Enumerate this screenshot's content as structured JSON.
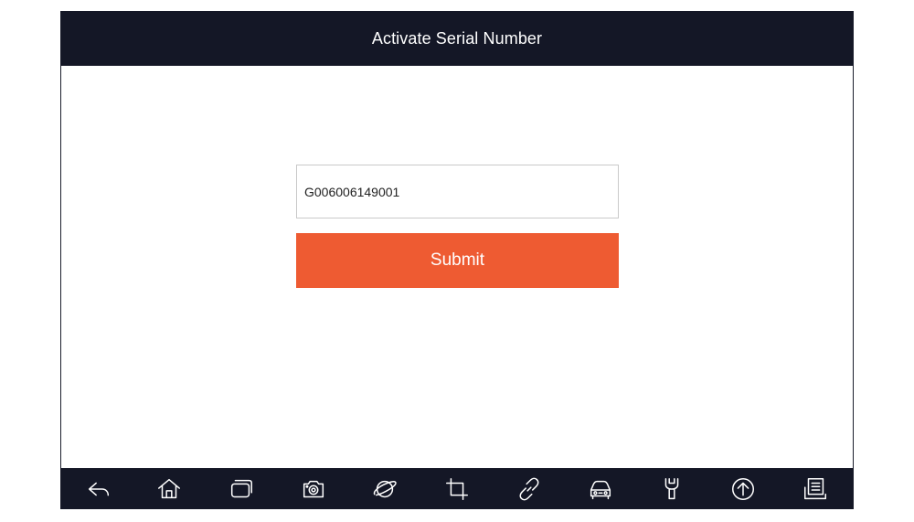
{
  "header": {
    "title": "Activate Serial Number"
  },
  "form": {
    "serial_value": "G006006149001",
    "submit_label": "Submit"
  },
  "colors": {
    "title_bar": "#141726",
    "submit_button": "#ee5b32",
    "nav_bar": "#141726"
  },
  "nav_bar": {
    "icons": [
      "back-icon",
      "home-icon",
      "recent-apps-icon",
      "camera-icon",
      "browser-icon",
      "crop-icon",
      "link-icon",
      "vehicle-icon",
      "repair-tool-icon",
      "upgrade-icon",
      "report-icon"
    ]
  }
}
